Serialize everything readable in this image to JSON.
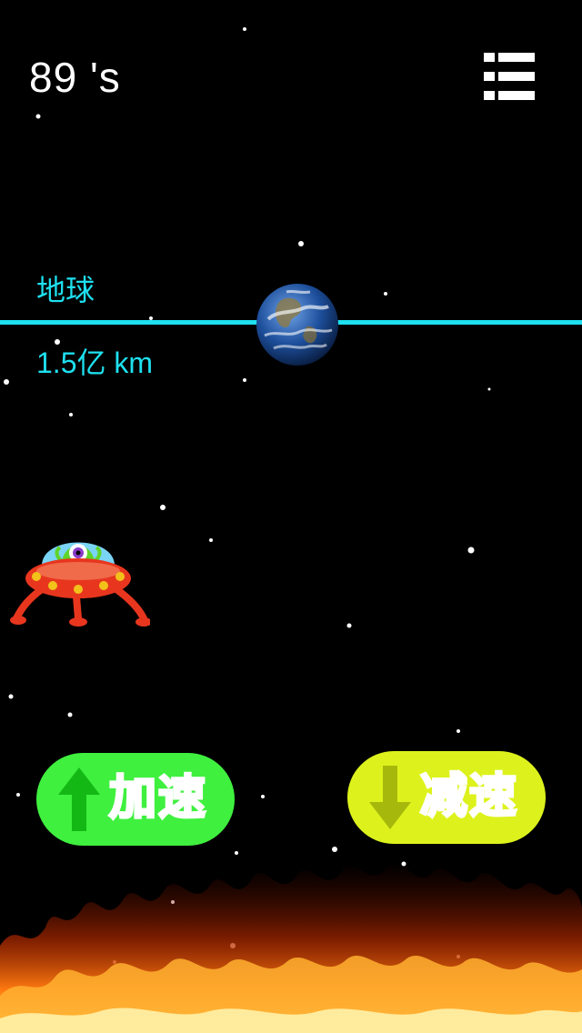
{
  "hud": {
    "timer": "89 's"
  },
  "planet": {
    "name": "地球",
    "distance": "1.5亿 km"
  },
  "controls": {
    "accelerate": "加速",
    "decelerate": "减速"
  },
  "icons": {
    "menu": "list-menu-icon",
    "planet": "earth-icon",
    "player": "ufo-alien-icon",
    "hazard": "fire-icon"
  },
  "colors": {
    "line": "#1ee0f0",
    "accelerate": "#3ff03f",
    "decelerate": "#ddf21c",
    "background": "#000000"
  }
}
